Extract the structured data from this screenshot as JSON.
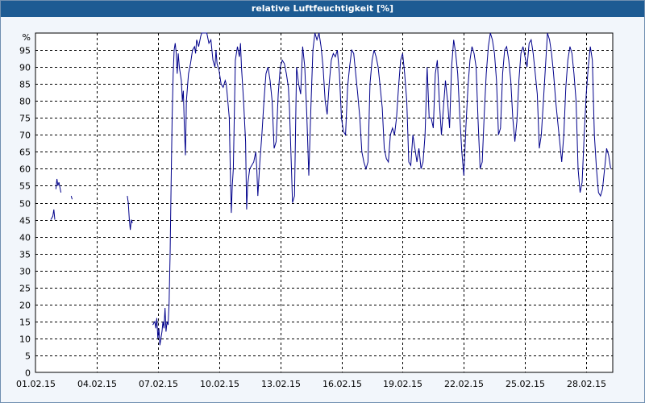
{
  "window": {
    "title": "relative Luftfeuchtigkeit [%]"
  },
  "colors": {
    "titlebar": "#1d5b93",
    "line": "#00008b",
    "plot_bg": "#ffffff",
    "grid": "#000000"
  },
  "chart_data": {
    "type": "line",
    "title": "relative Luftfeuchtigkeit [%]",
    "unit_label": "%",
    "xlabel": "",
    "ylabel": "",
    "ylim": [
      0,
      100
    ],
    "xlim": [
      0,
      28.3
    ],
    "yticks": [
      0,
      5,
      10,
      15,
      20,
      25,
      30,
      35,
      40,
      45,
      50,
      55,
      60,
      65,
      70,
      75,
      80,
      85,
      90,
      95
    ],
    "xticks": [
      {
        "x": 0,
        "label": "01.02.15"
      },
      {
        "x": 3,
        "label": "04.02.15"
      },
      {
        "x": 6,
        "label": "07.02.15"
      },
      {
        "x": 9,
        "label": "10.02.15"
      },
      {
        "x": 12,
        "label": "13.02.15"
      },
      {
        "x": 15,
        "label": "16.02.15"
      },
      {
        "x": 18,
        "label": "19.02.15"
      },
      {
        "x": 21,
        "label": "22.02.15"
      },
      {
        "x": 24,
        "label": "25.02.15"
      },
      {
        "x": 27,
        "label": "28.02.15"
      }
    ],
    "grid": true,
    "series": [
      {
        "segments": [
          [
            [
              0.75,
              45
            ],
            [
              0.85,
              46
            ],
            [
              0.9,
              48
            ],
            [
              0.95,
              45
            ]
          ],
          [
            [
              1.0,
              54
            ],
            [
              1.05,
              57
            ],
            [
              1.1,
              55
            ],
            [
              1.15,
              56
            ],
            [
              1.25,
              53
            ]
          ],
          [
            [
              1.75,
              52
            ],
            [
              1.8,
              51
            ]
          ],
          [
            [
              4.5,
              52
            ],
            [
              4.55,
              50
            ],
            [
              4.6,
              45
            ],
            [
              4.65,
              42
            ],
            [
              4.7,
              45
            ],
            [
              4.75,
              44
            ]
          ],
          [
            [
              5.75,
              14
            ],
            [
              5.85,
              15
            ],
            [
              5.9,
              13
            ],
            [
              5.95,
              16
            ],
            [
              6.0,
              10
            ],
            [
              6.05,
              13
            ],
            [
              6.1,
              8
            ],
            [
              6.15,
              10
            ],
            [
              6.2,
              12
            ],
            [
              6.25,
              15
            ],
            [
              6.3,
              13
            ],
            [
              6.35,
              19
            ],
            [
              6.4,
              12
            ],
            [
              6.45,
              15
            ],
            [
              6.5,
              14
            ],
            [
              6.55,
              20
            ],
            [
              6.6,
              35
            ],
            [
              6.65,
              55
            ],
            [
              6.7,
              75
            ],
            [
              6.75,
              88
            ],
            [
              6.8,
              95
            ],
            [
              6.85,
              97
            ],
            [
              6.9,
              94
            ],
            [
              6.95,
              88
            ],
            [
              7.0,
              94
            ],
            [
              7.05,
              90
            ],
            [
              7.15,
              86
            ],
            [
              7.2,
              80
            ],
            [
              7.25,
              83
            ],
            [
              7.3,
              72
            ],
            [
              7.35,
              64
            ],
            [
              7.4,
              80
            ],
            [
              7.5,
              88
            ],
            [
              7.6,
              91
            ],
            [
              7.7,
              95
            ],
            [
              7.8,
              96
            ],
            [
              7.85,
              94
            ],
            [
              7.9,
              98
            ],
            [
              8.0,
              96
            ],
            [
              8.1,
              99
            ],
            [
              8.15,
              100
            ],
            [
              8.3,
              100
            ],
            [
              8.4,
              100
            ],
            [
              8.5,
              97
            ],
            [
              8.6,
              98
            ],
            [
              8.7,
              92
            ],
            [
              8.8,
              90
            ],
            [
              8.85,
              95
            ],
            [
              8.9,
              91
            ],
            [
              9.0,
              89
            ],
            [
              9.1,
              85
            ],
            [
              9.2,
              84
            ],
            [
              9.3,
              86
            ],
            [
              9.35,
              85
            ],
            [
              9.4,
              82
            ],
            [
              9.5,
              75
            ],
            [
              9.55,
              60
            ],
            [
              9.6,
              47
            ],
            [
              9.65,
              55
            ],
            [
              9.7,
              60
            ],
            [
              9.8,
              92
            ],
            [
              9.9,
              96
            ],
            [
              10.0,
              93
            ],
            [
              10.05,
              97
            ],
            [
              10.1,
              90
            ],
            [
              10.2,
              80
            ],
            [
              10.3,
              68
            ],
            [
              10.35,
              48
            ],
            [
              10.4,
              55
            ],
            [
              10.5,
              60
            ],
            [
              10.6,
              61
            ],
            [
              10.7,
              62
            ],
            [
              10.8,
              65
            ],
            [
              10.85,
              60
            ],
            [
              10.9,
              52
            ],
            [
              11.0,
              62
            ],
            [
              11.1,
              70
            ],
            [
              11.2,
              80
            ],
            [
              11.3,
              88
            ],
            [
              11.4,
              90
            ],
            [
              11.5,
              86
            ],
            [
              11.6,
              80
            ],
            [
              11.7,
              66
            ],
            [
              11.8,
              68
            ],
            [
              11.9,
              82
            ],
            [
              12.0,
              90
            ],
            [
              12.1,
              92
            ],
            [
              12.2,
              91
            ],
            [
              12.3,
              88
            ],
            [
              12.4,
              84
            ],
            [
              12.45,
              78
            ],
            [
              12.55,
              60
            ],
            [
              12.6,
              50
            ],
            [
              12.7,
              52
            ],
            [
              12.8,
              90
            ],
            [
              12.9,
              85
            ],
            [
              13.0,
              82
            ],
            [
              13.1,
              96
            ],
            [
              13.2,
              90
            ],
            [
              13.3,
              76
            ],
            [
              13.4,
              58
            ],
            [
              13.5,
              78
            ],
            [
              13.6,
              95
            ],
            [
              13.7,
              100
            ],
            [
              13.8,
              98
            ],
            [
              13.9,
              100
            ],
            [
              14.0,
              96
            ],
            [
              14.1,
              90
            ],
            [
              14.2,
              80
            ],
            [
              14.3,
              76
            ],
            [
              14.4,
              85
            ],
            [
              14.5,
              92
            ],
            [
              14.6,
              94
            ],
            [
              14.7,
              93
            ],
            [
              14.8,
              95
            ],
            [
              14.9,
              88
            ],
            [
              15.0,
              75
            ],
            [
              15.1,
              71
            ],
            [
              15.2,
              70
            ],
            [
              15.3,
              84
            ],
            [
              15.4,
              90
            ],
            [
              15.5,
              95
            ],
            [
              15.6,
              94
            ],
            [
              15.7,
              88
            ],
            [
              15.8,
              82
            ],
            [
              15.9,
              75
            ],
            [
              16.0,
              65
            ],
            [
              16.1,
              62
            ],
            [
              16.2,
              60
            ],
            [
              16.3,
              62
            ],
            [
              16.4,
              85
            ],
            [
              16.5,
              92
            ],
            [
              16.6,
              95
            ],
            [
              16.7,
              93
            ],
            [
              16.8,
              90
            ],
            [
              16.9,
              84
            ],
            [
              17.0,
              78
            ],
            [
              17.1,
              66
            ],
            [
              17.2,
              63
            ],
            [
              17.3,
              62
            ],
            [
              17.4,
              70
            ],
            [
              17.5,
              72
            ],
            [
              17.6,
              70
            ],
            [
              17.7,
              75
            ],
            [
              17.8,
              84
            ],
            [
              17.9,
              92
            ],
            [
              18.0,
              94
            ],
            [
              18.1,
              88
            ],
            [
              18.2,
              80
            ],
            [
              18.3,
              62
            ],
            [
              18.4,
              61
            ],
            [
              18.5,
              70
            ],
            [
              18.6,
              66
            ],
            [
              18.7,
              62
            ],
            [
              18.8,
              66
            ],
            [
              18.9,
              60
            ],
            [
              19.0,
              62
            ],
            [
              19.1,
              70
            ],
            [
              19.2,
              90
            ],
            [
              19.3,
              75
            ],
            [
              19.4,
              75
            ],
            [
              19.5,
              72
            ],
            [
              19.6,
              88
            ],
            [
              19.7,
              92
            ],
            [
              19.8,
              80
            ],
            [
              19.9,
              70
            ],
            [
              20.0,
              78
            ],
            [
              20.1,
              86
            ],
            [
              20.2,
              80
            ],
            [
              20.3,
              72
            ],
            [
              20.4,
              90
            ],
            [
              20.5,
              98
            ],
            [
              20.6,
              94
            ],
            [
              20.7,
              88
            ],
            [
              20.8,
              76
            ],
            [
              20.9,
              65
            ],
            [
              21.0,
              58
            ],
            [
              21.1,
              72
            ],
            [
              21.2,
              84
            ],
            [
              21.3,
              92
            ],
            [
              21.4,
              96
            ],
            [
              21.5,
              94
            ],
            [
              21.6,
              90
            ],
            [
              21.7,
              74
            ],
            [
              21.8,
              60
            ],
            [
              21.9,
              62
            ],
            [
              22.0,
              76
            ],
            [
              22.1,
              88
            ],
            [
              22.2,
              96
            ],
            [
              22.3,
              100
            ],
            [
              22.4,
              98
            ],
            [
              22.5,
              94
            ],
            [
              22.6,
              86
            ],
            [
              22.7,
              70
            ],
            [
              22.8,
              72
            ],
            [
              22.9,
              88
            ],
            [
              23.0,
              95
            ],
            [
              23.1,
              96
            ],
            [
              23.2,
              92
            ],
            [
              23.3,
              86
            ],
            [
              23.4,
              75
            ],
            [
              23.5,
              68
            ],
            [
              23.6,
              74
            ],
            [
              23.7,
              86
            ],
            [
              23.8,
              94
            ],
            [
              23.9,
              96
            ],
            [
              24.0,
              93
            ],
            [
              24.1,
              90
            ],
            [
              24.2,
              97
            ],
            [
              24.3,
              98
            ],
            [
              24.4,
              94
            ],
            [
              24.5,
              88
            ],
            [
              24.6,
              82
            ],
            [
              24.7,
              66
            ],
            [
              24.8,
              70
            ],
            [
              24.9,
              80
            ],
            [
              25.0,
              90
            ],
            [
              25.1,
              100
            ],
            [
              25.2,
              98
            ],
            [
              25.3,
              94
            ],
            [
              25.4,
              88
            ],
            [
              25.5,
              80
            ],
            [
              25.6,
              74
            ],
            [
              25.7,
              68
            ],
            [
              25.8,
              62
            ],
            [
              25.9,
              70
            ],
            [
              26.0,
              84
            ],
            [
              26.1,
              92
            ],
            [
              26.2,
              96
            ],
            [
              26.3,
              94
            ],
            [
              26.4,
              88
            ],
            [
              26.5,
              80
            ],
            [
              26.6,
              60
            ],
            [
              26.7,
              53
            ],
            [
              26.8,
              56
            ],
            [
              26.9,
              70
            ],
            [
              27.0,
              82
            ],
            [
              27.1,
              90
            ],
            [
              27.2,
              96
            ],
            [
              27.3,
              92
            ],
            [
              27.4,
              70
            ],
            [
              27.5,
              60
            ],
            [
              27.6,
              53
            ],
            [
              27.7,
              52
            ],
            [
              27.8,
              54
            ],
            [
              27.9,
              60
            ],
            [
              28.0,
              66
            ],
            [
              28.1,
              64
            ],
            [
              28.2,
              60
            ]
          ]
        ]
      }
    ]
  }
}
